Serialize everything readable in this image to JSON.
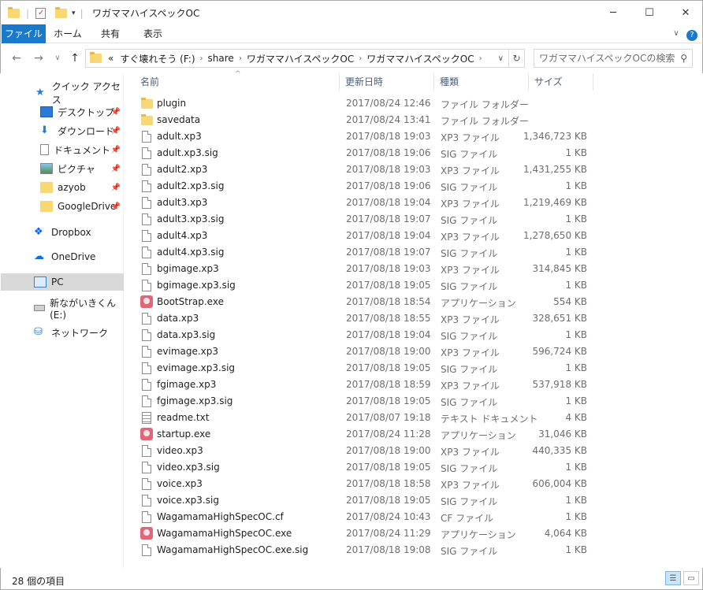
{
  "window": {
    "title": "ワガママハイスペックOC"
  },
  "ribbon": {
    "tabs": [
      "ファイル",
      "ホーム",
      "共有",
      "表示"
    ]
  },
  "address": {
    "crumbs": [
      "«",
      "すぐ壊れそう (F:)",
      "share",
      "ワガママハイスペックOC",
      "ワガママハイスペックOC"
    ]
  },
  "search": {
    "placeholder": "ワガママハイスペックOCの検索"
  },
  "nav": {
    "items": [
      {
        "label": "クイック アクセス",
        "icon": "star-icon"
      },
      {
        "label": "デスクトップ",
        "icon": "desktop-icon",
        "pinned": true
      },
      {
        "label": "ダウンロード",
        "icon": "download-icon",
        "pinned": true
      },
      {
        "label": "ドキュメント",
        "icon": "document-icon",
        "pinned": true
      },
      {
        "label": "ピクチャ",
        "icon": "picture-icon",
        "pinned": true
      },
      {
        "label": "azyob",
        "icon": "folder-icon",
        "pinned": true
      },
      {
        "label": "GoogleDrive",
        "icon": "folder-icon",
        "pinned": true
      },
      {
        "label": "Dropbox",
        "icon": "dropbox-icon"
      },
      {
        "label": "OneDrive",
        "icon": "onedrive-icon"
      },
      {
        "label": "PC",
        "icon": "pc-icon",
        "selected": true
      },
      {
        "label": "新ながいきくん (E:)",
        "icon": "drive-icon"
      },
      {
        "label": "ネットワーク",
        "icon": "network-icon"
      }
    ]
  },
  "columns": [
    "名前",
    "更新日時",
    "種類",
    "サイズ"
  ],
  "files": [
    {
      "name": "plugin",
      "date": "2017/08/24 12:46",
      "type": "ファイル フォルダー",
      "size": "",
      "kind": "folder"
    },
    {
      "name": "savedata",
      "date": "2017/08/24 13:41",
      "type": "ファイル フォルダー",
      "size": "",
      "kind": "folder"
    },
    {
      "name": "adult.xp3",
      "date": "2017/08/18 19:03",
      "type": "XP3 ファイル",
      "size": "1,346,723 KB",
      "kind": "file"
    },
    {
      "name": "adult.xp3.sig",
      "date": "2017/08/18 19:06",
      "type": "SIG ファイル",
      "size": "1 KB",
      "kind": "file"
    },
    {
      "name": "adult2.xp3",
      "date": "2017/08/18 19:03",
      "type": "XP3 ファイル",
      "size": "1,431,255 KB",
      "kind": "file"
    },
    {
      "name": "adult2.xp3.sig",
      "date": "2017/08/18 19:06",
      "type": "SIG ファイル",
      "size": "1 KB",
      "kind": "file"
    },
    {
      "name": "adult3.xp3",
      "date": "2017/08/18 19:04",
      "type": "XP3 ファイル",
      "size": "1,219,469 KB",
      "kind": "file"
    },
    {
      "name": "adult3.xp3.sig",
      "date": "2017/08/18 19:07",
      "type": "SIG ファイル",
      "size": "1 KB",
      "kind": "file"
    },
    {
      "name": "adult4.xp3",
      "date": "2017/08/18 19:04",
      "type": "XP3 ファイル",
      "size": "1,278,650 KB",
      "kind": "file"
    },
    {
      "name": "adult4.xp3.sig",
      "date": "2017/08/18 19:07",
      "type": "SIG ファイル",
      "size": "1 KB",
      "kind": "file"
    },
    {
      "name": "bgimage.xp3",
      "date": "2017/08/18 19:03",
      "type": "XP3 ファイル",
      "size": "314,845 KB",
      "kind": "file"
    },
    {
      "name": "bgimage.xp3.sig",
      "date": "2017/08/18 19:05",
      "type": "SIG ファイル",
      "size": "1 KB",
      "kind": "file"
    },
    {
      "name": "BootStrap.exe",
      "date": "2017/08/18 18:54",
      "type": "アプリケーション",
      "size": "554 KB",
      "kind": "exe"
    },
    {
      "name": "data.xp3",
      "date": "2017/08/18 18:55",
      "type": "XP3 ファイル",
      "size": "328,651 KB",
      "kind": "file"
    },
    {
      "name": "data.xp3.sig",
      "date": "2017/08/18 19:04",
      "type": "SIG ファイル",
      "size": "1 KB",
      "kind": "file"
    },
    {
      "name": "evimage.xp3",
      "date": "2017/08/18 19:00",
      "type": "XP3 ファイル",
      "size": "596,724 KB",
      "kind": "file"
    },
    {
      "name": "evimage.xp3.sig",
      "date": "2017/08/18 19:05",
      "type": "SIG ファイル",
      "size": "1 KB",
      "kind": "file"
    },
    {
      "name": "fgimage.xp3",
      "date": "2017/08/18 18:59",
      "type": "XP3 ファイル",
      "size": "537,918 KB",
      "kind": "file"
    },
    {
      "name": "fgimage.xp3.sig",
      "date": "2017/08/18 19:05",
      "type": "SIG ファイル",
      "size": "1 KB",
      "kind": "file"
    },
    {
      "name": "readme.txt",
      "date": "2017/08/07 19:18",
      "type": "テキスト ドキュメント",
      "size": "4 KB",
      "kind": "text"
    },
    {
      "name": "startup.exe",
      "date": "2017/08/24 11:28",
      "type": "アプリケーション",
      "size": "31,046 KB",
      "kind": "exe"
    },
    {
      "name": "video.xp3",
      "date": "2017/08/18 19:00",
      "type": "XP3 ファイル",
      "size": "440,335 KB",
      "kind": "file"
    },
    {
      "name": "video.xp3.sig",
      "date": "2017/08/18 19:05",
      "type": "SIG ファイル",
      "size": "1 KB",
      "kind": "file"
    },
    {
      "name": "voice.xp3",
      "date": "2017/08/18 18:58",
      "type": "XP3 ファイル",
      "size": "606,004 KB",
      "kind": "file"
    },
    {
      "name": "voice.xp3.sig",
      "date": "2017/08/18 19:05",
      "type": "SIG ファイル",
      "size": "1 KB",
      "kind": "file"
    },
    {
      "name": "WagamamaHighSpecOC.cf",
      "date": "2017/08/24 10:43",
      "type": "CF ファイル",
      "size": "1 KB",
      "kind": "file"
    },
    {
      "name": "WagamamaHighSpecOC.exe",
      "date": "2017/08/24 11:29",
      "type": "アプリケーション",
      "size": "4,064 KB",
      "kind": "exe"
    },
    {
      "name": "WagamamaHighSpecOC.exe.sig",
      "date": "2017/08/18 19:08",
      "type": "SIG ファイル",
      "size": "1 KB",
      "kind": "file"
    }
  ],
  "status": {
    "count_text": "28 個の項目"
  },
  "colors": {
    "accent": "#1979ca",
    "folder": "#f8d775",
    "selected_nav": "#d9d9d9"
  }
}
